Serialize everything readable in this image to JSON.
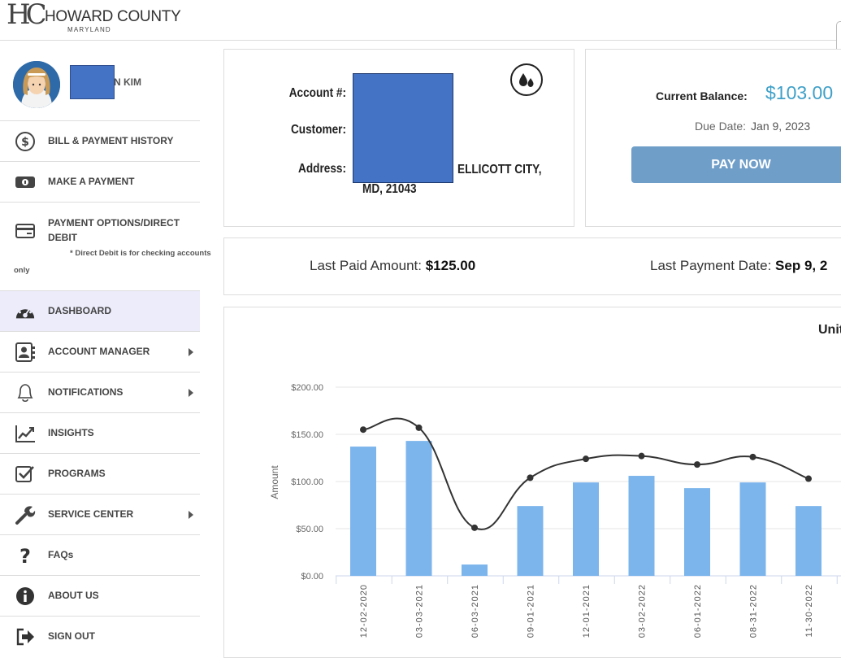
{
  "header": {
    "logo_mono": "HC",
    "org_name": "HOWARD COUNTY",
    "org_state": "MARYLAND"
  },
  "profile": {
    "name_suffix": "N KIM"
  },
  "sidebar": {
    "items": [
      {
        "label": "BILL & PAYMENT HISTORY",
        "icon": "dollar-icon"
      },
      {
        "label": "MAKE A PAYMENT",
        "icon": "cash-icon"
      },
      {
        "label": "PAYMENT OPTIONS/DIRECT DEBIT",
        "icon": "credit-card-icon",
        "note": "* Direct Debit is for checking accounts",
        "note_cont": "only"
      },
      {
        "label": "DASHBOARD",
        "icon": "gauge-icon",
        "active": true
      },
      {
        "label": "ACCOUNT MANAGER",
        "icon": "contact-book-icon",
        "submenu": true
      },
      {
        "label": "NOTIFICATIONS",
        "icon": "bell-icon",
        "submenu": true
      },
      {
        "label": "INSIGHTS",
        "icon": "trend-chart-icon"
      },
      {
        "label": "PROGRAMS",
        "icon": "checkbox-icon"
      },
      {
        "label": "SERVICE CENTER",
        "icon": "wrench-icon",
        "submenu": true
      },
      {
        "label": "FAQs",
        "icon": "question-icon"
      },
      {
        "label": "ABOUT US",
        "icon": "info-icon"
      },
      {
        "label": "SIGN OUT",
        "icon": "sign-out-icon"
      }
    ]
  },
  "account": {
    "account_label": "Account #:",
    "customer_label": "Customer:",
    "address_label": "Address:",
    "address_line1": "ELLICOTT CITY,",
    "address_line2": "MD, 21043",
    "service_icon": "water-drops-icon"
  },
  "balance": {
    "label": "Current Balance:",
    "value": "$103.00",
    "due_label": "Due Date:",
    "due_value": "Jan 9, 2023",
    "pay_button": "PAY NOW",
    "button_color": "#6f9ec9",
    "value_color": "#3fa0c8"
  },
  "last_payment": {
    "amount_label": "Last Paid Amount:",
    "amount_value": "$125.00",
    "date_label": "Last Payment Date:",
    "date_value": "Sep 9, 2"
  },
  "chart_data": {
    "type": "bar",
    "title": "Unit",
    "ylabel": "Amount",
    "xlabel": "",
    "ylim": [
      0,
      200
    ],
    "y_ticks": [
      "$0.00",
      "$50.00",
      "$100.00",
      "$150.00",
      "$200.00"
    ],
    "categories": [
      "12-02-2020",
      "03-03-2021",
      "06-03-2021",
      "09-01-2021",
      "12-01-2021",
      "03-02-2022",
      "06-01-2022",
      "08-31-2022",
      "11-30-2022"
    ],
    "series": [
      {
        "kind": "bar",
        "color": "#7cb5ec",
        "values": [
          137,
          143,
          12,
          74,
          99,
          106,
          93,
          99,
          74
        ]
      },
      {
        "kind": "line",
        "color": "#333333",
        "values": [
          155,
          157,
          51,
          104,
          124,
          127,
          118,
          126,
          103
        ]
      }
    ],
    "grid": true
  }
}
